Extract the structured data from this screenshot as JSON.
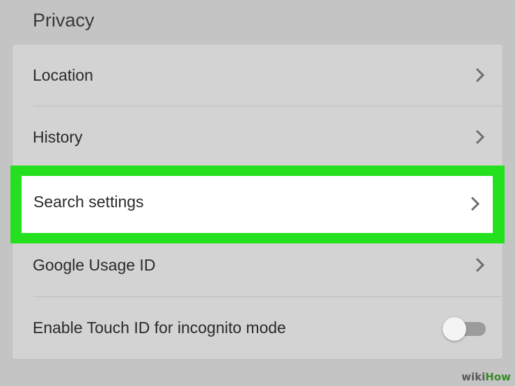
{
  "section": {
    "title": "Privacy"
  },
  "items": [
    {
      "label": "Location",
      "control": "chevron-right-icon"
    },
    {
      "label": "History",
      "control": "chevron-right-icon"
    },
    {
      "label": "Search settings",
      "control": "chevron-right-icon",
      "highlighted": true
    },
    {
      "label": "Google Usage ID",
      "control": "chevron-right-icon"
    },
    {
      "label": "Enable Touch ID for incognito mode",
      "control": "toggle",
      "toggle_on": false
    }
  ],
  "watermark": {
    "wiki": "wiki",
    "how": "How"
  },
  "colors": {
    "background": "#c4c4c4",
    "card": "#d3d3d3",
    "highlight": "#25e01f",
    "highlight_fill": "#ffffff",
    "text": "#2a2a2a"
  }
}
